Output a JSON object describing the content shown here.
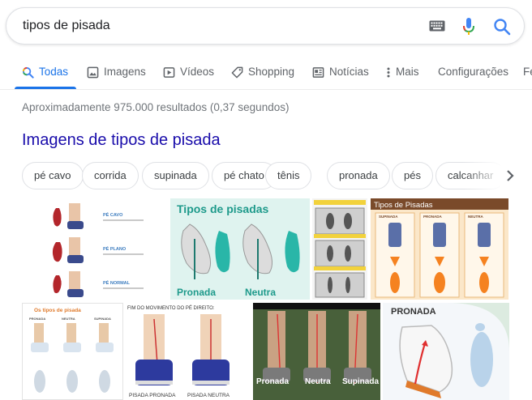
{
  "search": {
    "query": "tipos de pisada"
  },
  "tabs": [
    {
      "label": "Todas"
    },
    {
      "label": "Imagens"
    },
    {
      "label": "Vídeos"
    },
    {
      "label": "Shopping"
    },
    {
      "label": "Notícias"
    },
    {
      "label": "Mais"
    },
    {
      "label": "Configurações"
    },
    {
      "label": "Fe"
    }
  ],
  "results_count": "Aproximadamente 975.000 resultados (0,37 segundos)",
  "images_heading": "Imagens de tipos de pisada",
  "chips": [
    "pé cavo",
    "corrida",
    "supinada",
    "pé chato",
    "tênis",
    "pronada",
    "pés",
    "calcanhar"
  ],
  "thumbs": {
    "t1": {
      "labels": [
        "PÉ CAVO",
        "PÉ PLANO",
        "PÉ NORMAL"
      ]
    },
    "t2": {
      "title": "Tipos de pisadas",
      "left": "Pronada",
      "right": "Neutra"
    },
    "t4": {
      "title": "Tipos de Pisadas",
      "cols": [
        "SUPINADA",
        "PRONADA",
        "NEUTRA"
      ]
    },
    "t5": {
      "title": "Os tipos de pisada",
      "cols": [
        "PRONADA",
        "NEUTRA",
        "SUPINADA"
      ]
    },
    "t6": {
      "title": "FIM DO MOVIMENTO DO PÉ DIREITO:",
      "left": "PISADA PRONADA",
      "right": "PISADA NEUTRA"
    },
    "t7": {
      "labels": [
        "Pronada",
        "Neutra",
        "Supinada"
      ]
    },
    "t8": {
      "title": "PRONADA"
    }
  },
  "colors": {
    "accent": "#1a73e8",
    "link": "#1a0dab",
    "teal": "#29b6a8",
    "orange": "#f58220"
  }
}
